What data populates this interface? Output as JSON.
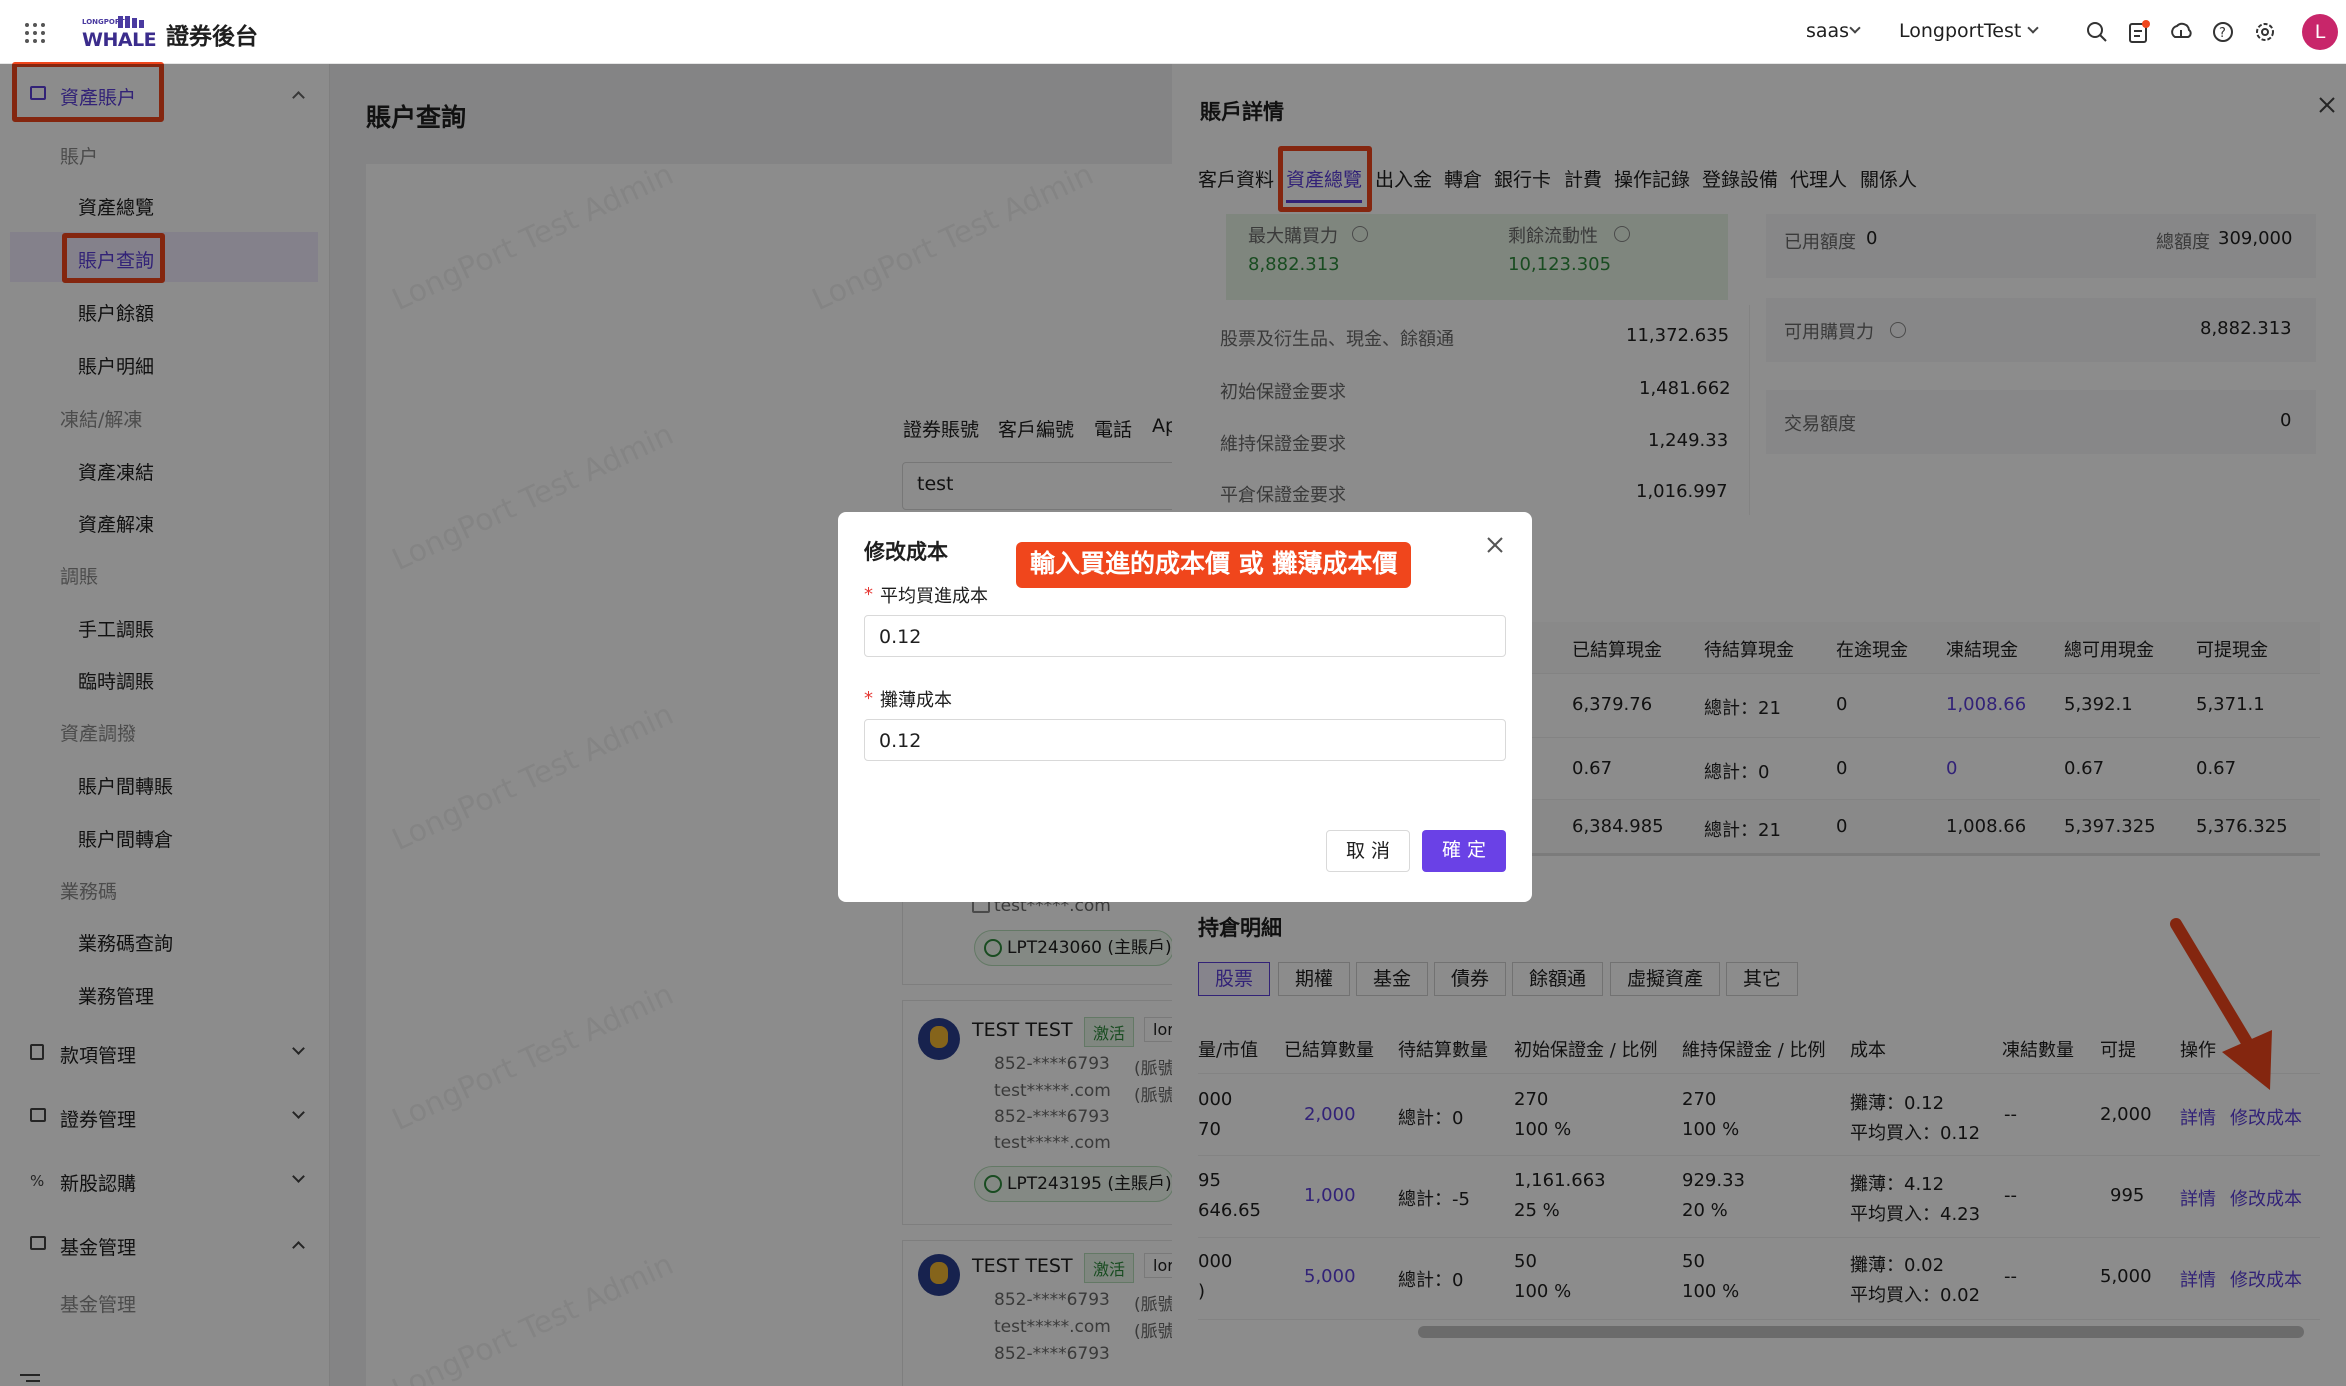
{
  "app": {
    "brand_small": "LONGPORT",
    "brand": "WHALE",
    "title": "證券後台"
  },
  "topbar": {
    "tenant": "saas",
    "org": "LongportTest",
    "avatar_letter": "L"
  },
  "sidebar": {
    "section": "資產賬户",
    "groups": [
      {
        "label": "賬户",
        "items": [
          "資產總覽",
          "賬户查詢",
          "賬户餘額",
          "賬户明細"
        ]
      },
      {
        "label": "凍結/解凍",
        "items": [
          "資產凍結",
          "資產解凍"
        ]
      },
      {
        "label": "調賬",
        "items": [
          "手工調賬",
          "臨時調賬"
        ]
      },
      {
        "label": "資產調撥",
        "items": [
          "賬户間轉賬",
          "賬户間轉倉"
        ]
      },
      {
        "label": "業務碼",
        "items": [
          "業務碼查詢",
          "業務管理"
        ]
      }
    ],
    "menus": [
      "款項管理",
      "證券管理",
      "新股認購",
      "基金管理"
    ],
    "fund_sub": "基金管理"
  },
  "main": {
    "title": "賬户查詢",
    "filters": [
      "證券賬號",
      "客戶編號",
      "電話",
      "Ap"
    ],
    "search_value": "test",
    "watermark": "LongPort Test Admin",
    "users": [
      {
        "name": "TEST TEST",
        "status": "激活",
        "tag": "lor",
        "phone1": "852-****6793",
        "phone1_note": "(脈號",
        "email1": "test*****.com",
        "email1_note": "(脈號",
        "phone2": "852-****6793",
        "email2": "test*****.com",
        "account": "LPT243195 (主賬戶)"
      },
      {
        "name": "TEST TEST",
        "status": "激活",
        "tag": "lor",
        "phone1": "852-****6793",
        "phone1_note": "(脈號",
        "email1": "test*****.com",
        "email1_note": "(脈號",
        "phone2": "852-****6793"
      }
    ],
    "prev_email": "test*****.com",
    "prev_account": "LPT243060 (主賬戶)"
  },
  "drawer": {
    "title": "賬戶詳情",
    "tabs": [
      "客戶資料",
      "資產總覽",
      "出入金",
      "轉倉",
      "銀行卡",
      "計費",
      "操作記錄",
      "登錄設備",
      "代理人",
      "關係人"
    ],
    "max_buy_label": "最大購買力",
    "max_buy_value": "8,882.313",
    "liquidity_label": "剩餘流動性",
    "liquidity_value": "10,123.305",
    "left_rows": [
      {
        "label": "股票及衍生品、現金、餘額通",
        "value": "11,372.635"
      },
      {
        "label": "初始保證金要求",
        "value": "1,481.662"
      },
      {
        "label": "維持保證金要求",
        "value": "1,249.33"
      },
      {
        "label": "平倉保證金要求",
        "value": "1,016.997"
      }
    ],
    "used_label": "已用額度",
    "used_value": "0",
    "total_label": "總額度",
    "total_value": "309,000",
    "avail_label": "可用購買力",
    "avail_value": "8,882.313",
    "trade_label": "交易額度",
    "trade_value": "0",
    "cash_headers": [
      "已結算現金",
      "待結算現金",
      "在途現金",
      "凍結現金",
      "總可用現金",
      "可提現金"
    ],
    "cash_rows": [
      [
        "6,379.76",
        "總計：21",
        "0",
        "1,008.66",
        "5,392.1",
        "5,371.1"
      ],
      [
        "0.67",
        "總計：0",
        "0",
        "0",
        "0.67",
        "0.67"
      ],
      [
        "6,384.985",
        "總計：21",
        "0",
        "1,008.66",
        "5,397.325",
        "5,376.325"
      ]
    ],
    "holdings_title": "持倉明細",
    "holding_tabs": [
      "股票",
      "期權",
      "基金",
      "債券",
      "餘額通",
      "虛擬資產",
      "其它"
    ],
    "hold_headers": [
      "量/市值",
      "已結算數量",
      "待結算數量",
      "初始保證金 / 比例",
      "維持保證金 / 比例",
      "成本",
      "凍結數量",
      "可提",
      "操作"
    ],
    "hold_rows": [
      {
        "qty": "000",
        "mv": "70",
        "settled": "2,000",
        "pending": "總計：0",
        "im": "270",
        "im_pct": "100 %",
        "mm": "270",
        "mm_pct": "100 %",
        "cost1": "攤薄：0.12",
        "cost2": "平均買入：0.12",
        "frozen": "--",
        "withdraw": "2,000",
        "op1": "詳情",
        "op2": "修改成本"
      },
      {
        "qty": "95",
        "mv": "646.65",
        "settled": "1,000",
        "pending": "總計：-5",
        "im": "1,161.663",
        "im_pct": "25 %",
        "mm": "929.33",
        "mm_pct": "20 %",
        "cost1": "攤薄：4.12",
        "cost2": "平均買入：4.23",
        "frozen": "--",
        "withdraw": "995",
        "op1": "詳情",
        "op2": "修改成本"
      },
      {
        "qty": "000",
        "mv": ")",
        "settled": "5,000",
        "pending": "總計：0",
        "im": "50",
        "im_pct": "100 %",
        "mm": "50",
        "mm_pct": "100 %",
        "cost1": "攤薄：0.02",
        "cost2": "平均買入：0.02",
        "frozen": "--",
        "withdraw": "5,000",
        "op1": "詳情",
        "op2": "修改成本"
      }
    ]
  },
  "modal": {
    "title": "修改成本",
    "annotation": "輸入買進的成本價 或 攤薄成本價",
    "avg_label": "平均買進成本",
    "avg_value": "0.12",
    "dil_label": "攤薄成本",
    "dil_value": "0.12",
    "cancel": "取 消",
    "ok": "確 定"
  },
  "colors": {
    "accent": "#6a41e6",
    "annotation": "#f0461c",
    "positive": "#2e8b3c",
    "link": "#5b3fd9"
  }
}
